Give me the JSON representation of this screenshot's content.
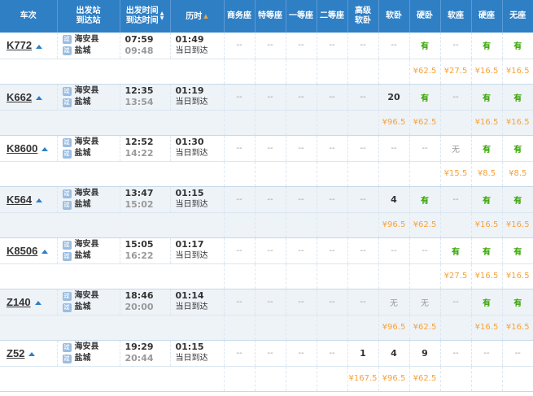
{
  "headers": {
    "train": "车次",
    "station_from": "出发站",
    "station_to": "到达站",
    "time_dep": "出发时间",
    "time_arr": "到达时间",
    "duration": "历时",
    "seats": [
      "商务座",
      "特等座",
      "一等座",
      "二等座",
      "高级\n软卧",
      "软卧",
      "硬卧",
      "软座",
      "硬座",
      "无座"
    ]
  },
  "trains": [
    {
      "no": "K772",
      "from": "海安县",
      "to": "盐城",
      "from_badge": "过",
      "to_badge": "过",
      "dep": "07:59",
      "arr": "09:48",
      "dur": "01:49",
      "arrival_day": "当日到达",
      "seats": [
        "--",
        "--",
        "--",
        "--",
        "--",
        "--",
        "有",
        "--",
        "有",
        "有"
      ],
      "prices": [
        "",
        "",
        "",
        "",
        "",
        "",
        "¥62.5",
        "¥27.5",
        "¥16.5",
        "¥16.5"
      ]
    },
    {
      "no": "K662",
      "from": "海安县",
      "to": "盐城",
      "from_badge": "过",
      "to_badge": "过",
      "dep": "12:35",
      "arr": "13:54",
      "dur": "01:19",
      "arrival_day": "当日到达",
      "seats": [
        "--",
        "--",
        "--",
        "--",
        "--",
        "20",
        "有",
        "--",
        "有",
        "有"
      ],
      "prices": [
        "",
        "",
        "",
        "",
        "",
        "¥96.5",
        "¥62.5",
        "",
        "¥16.5",
        "¥16.5"
      ]
    },
    {
      "no": "K8600",
      "from": "海安县",
      "to": "盐城",
      "from_badge": "过",
      "to_badge": "过",
      "dep": "12:52",
      "arr": "14:22",
      "dur": "01:30",
      "arrival_day": "当日到达",
      "seats": [
        "--",
        "--",
        "--",
        "--",
        "--",
        "--",
        "--",
        "无",
        "有",
        "有"
      ],
      "prices": [
        "",
        "",
        "",
        "",
        "",
        "",
        "",
        "¥15.5",
        "¥8.5",
        "¥8.5"
      ]
    },
    {
      "no": "K564",
      "from": "海安县",
      "to": "盐城",
      "from_badge": "过",
      "to_badge": "过",
      "dep": "13:47",
      "arr": "15:02",
      "dur": "01:15",
      "arrival_day": "当日到达",
      "seats": [
        "--",
        "--",
        "--",
        "--",
        "--",
        "4",
        "有",
        "--",
        "有",
        "有"
      ],
      "prices": [
        "",
        "",
        "",
        "",
        "",
        "¥96.5",
        "¥62.5",
        "",
        "¥16.5",
        "¥16.5"
      ]
    },
    {
      "no": "K8506",
      "from": "海安县",
      "to": "盐城",
      "from_badge": "过",
      "to_badge": "过",
      "dep": "15:05",
      "arr": "16:22",
      "dur": "01:17",
      "arrival_day": "当日到达",
      "seats": [
        "--",
        "--",
        "--",
        "--",
        "--",
        "--",
        "--",
        "有",
        "有",
        "有"
      ],
      "prices": [
        "",
        "",
        "",
        "",
        "",
        "",
        "",
        "¥27.5",
        "¥16.5",
        "¥16.5"
      ]
    },
    {
      "no": "Z140",
      "from": "海安县",
      "to": "盐城",
      "from_badge": "过",
      "to_badge": "过",
      "dep": "18:46",
      "arr": "20:00",
      "dur": "01:14",
      "arrival_day": "当日到达",
      "seats": [
        "--",
        "--",
        "--",
        "--",
        "--",
        "无",
        "无",
        "--",
        "有",
        "有"
      ],
      "prices": [
        "",
        "",
        "",
        "",
        "",
        "¥96.5",
        "¥62.5",
        "",
        "¥16.5",
        "¥16.5"
      ]
    },
    {
      "no": "Z52",
      "from": "海安县",
      "to": "盐城",
      "from_badge": "过",
      "to_badge": "过",
      "dep": "19:29",
      "arr": "20:44",
      "dur": "01:15",
      "arrival_day": "当日到达",
      "seats": [
        "--",
        "--",
        "--",
        "--",
        "1",
        "4",
        "9",
        "--",
        "--",
        "--"
      ],
      "prices": [
        "",
        "",
        "",
        "",
        "¥167.5",
        "¥96.5",
        "¥62.5",
        "",
        "",
        ""
      ]
    }
  ],
  "colors": {
    "header_bg": "#2f7fc5",
    "available": "#36a400",
    "price": "#f7a23a",
    "row_shade": "#eef3f8"
  }
}
